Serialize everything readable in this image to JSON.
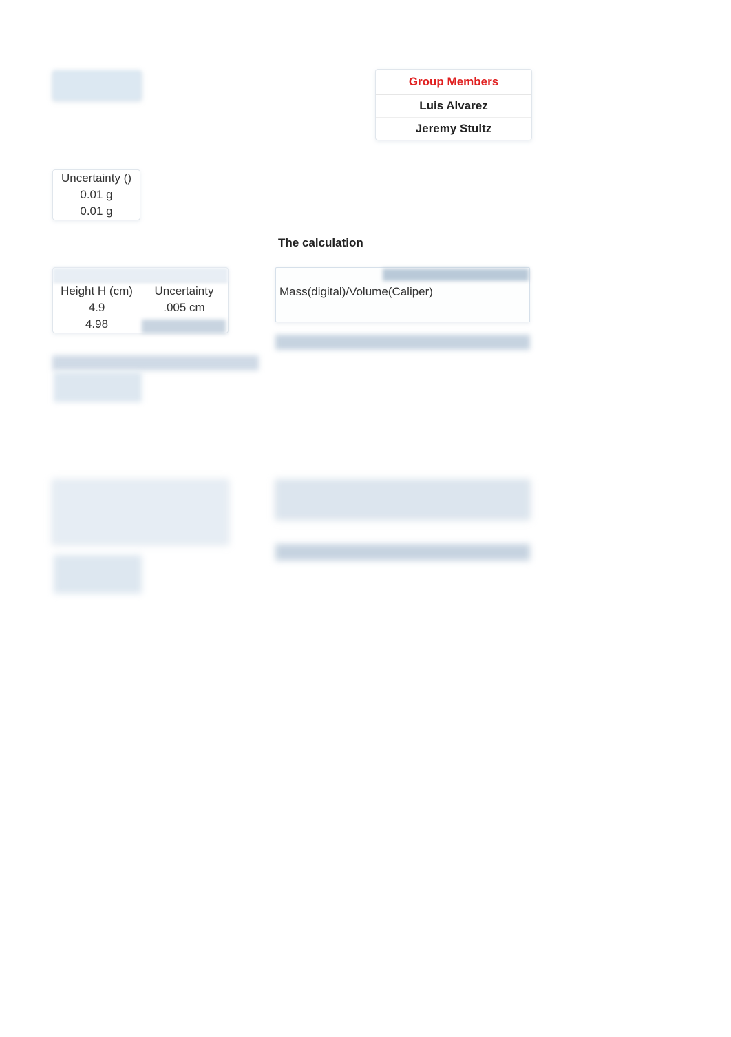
{
  "group": {
    "header": "Group Members",
    "members": [
      "Luis Alvarez",
      "Jeremy Stultz"
    ]
  },
  "uncertainty_box": {
    "header": "Uncertainty ()",
    "rows": [
      "0.01 g",
      "0.01 g"
    ]
  },
  "section_title": "The calculation",
  "height_table": {
    "headers": [
      "Height H (cm)",
      "Uncertainty"
    ],
    "rows": [
      [
        "4.9",
        ".005 cm"
      ],
      [
        "4.98",
        ""
      ]
    ]
  },
  "calc_box": {
    "text": "Mass(digital)/Volume(Caliper)"
  }
}
